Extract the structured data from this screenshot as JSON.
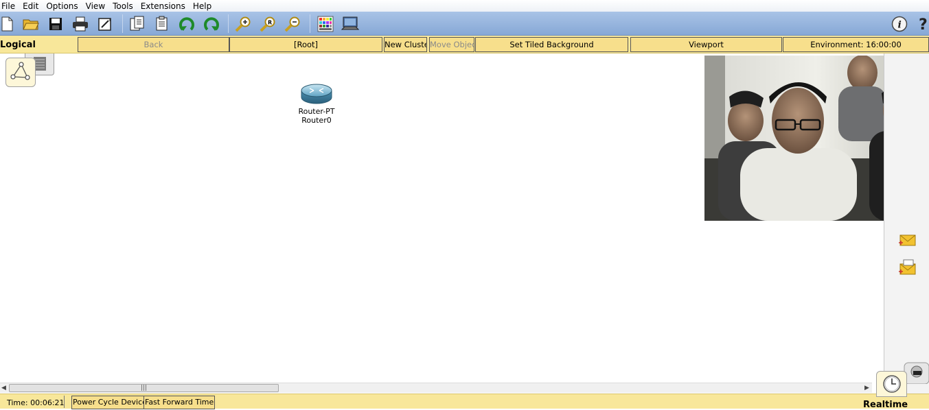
{
  "menu": [
    "File",
    "Edit",
    "Options",
    "View",
    "Tools",
    "Extensions",
    "Help"
  ],
  "toolbar": {
    "icons": [
      "new-file-icon",
      "open-folder-icon",
      "save-icon",
      "print-icon",
      "activity-wizard-icon",
      "copy-icon",
      "paste-icon",
      "undo-icon",
      "redo-icon",
      "zoom-in-icon",
      "zoom-reset-icon",
      "zoom-out-icon",
      "palette-icon",
      "device-template-icon",
      "info-icon",
      "help-icon"
    ]
  },
  "nav": {
    "workspace_label": "Logical",
    "back": "Back",
    "root": "[Root]",
    "new_cluster": "New Cluster",
    "move_object": "Move Object",
    "set_tiled_background": "Set Tiled Background",
    "viewport": "Viewport",
    "environment": "Environment: 16:00:00"
  },
  "device": {
    "model": "Router-PT",
    "name": "Router0"
  },
  "status": {
    "time": "Time: 00:06:21",
    "power_cycle": "Power Cycle Devices",
    "fast_forward": "Fast Forward Time",
    "mode": "Realtime"
  },
  "colors": {
    "toolbar_blue": "#87a8d6",
    "yellow_bar": "#f8e79a",
    "button_fill": "#f7df8c"
  }
}
